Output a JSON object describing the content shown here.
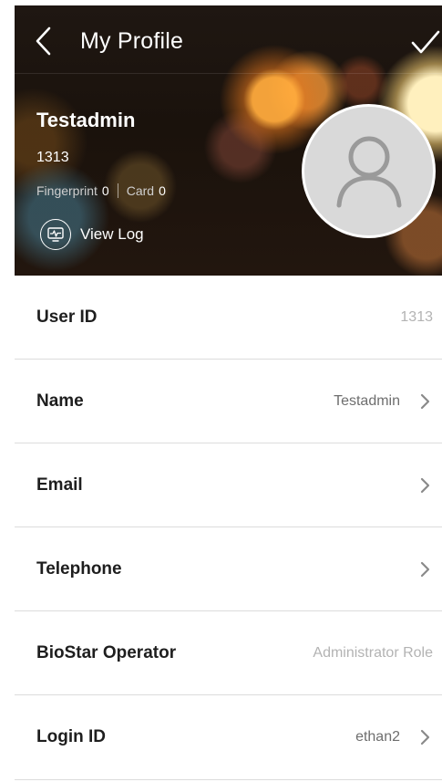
{
  "header": {
    "title": "My Profile",
    "back_icon": "chevron-left-icon",
    "confirm_icon": "checkmark-icon"
  },
  "profile": {
    "name": "Testadmin",
    "code": "1313",
    "fingerprint_label": "Fingerprint",
    "fingerprint_count": "0",
    "card_label": "Card",
    "card_count": "0",
    "view_log_label": "View Log",
    "view_log_icon": "log-monitor-icon",
    "avatar_icon": "user-avatar-placeholder-icon"
  },
  "fields": [
    {
      "label": "User ID",
      "value": "1313",
      "editable": false
    },
    {
      "label": "Name",
      "value": "Testadmin",
      "editable": true
    },
    {
      "label": "Email",
      "value": "",
      "editable": true
    },
    {
      "label": "Telephone",
      "value": "",
      "editable": true
    },
    {
      "label": "BioStar Operator",
      "value": "Administrator Role",
      "editable": false
    },
    {
      "label": "Login ID",
      "value": "ethan2",
      "editable": true
    }
  ],
  "colors": {
    "label_text": "#1e1e1e",
    "value_text": "#6e6e6e",
    "muted_value_text": "#b3b3b3",
    "divider": "#dcdcdc",
    "header_text": "#ffffff"
  }
}
